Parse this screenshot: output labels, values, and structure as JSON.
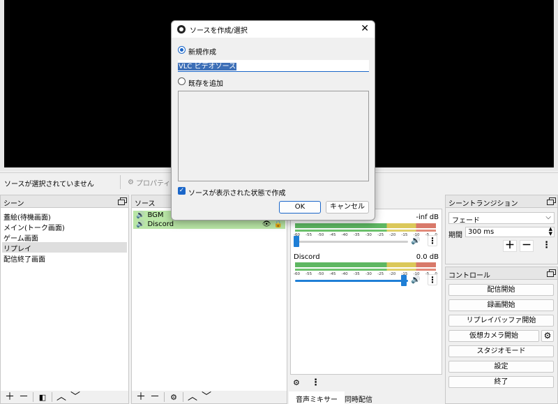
{
  "source_bar": {
    "no_source": "ソースが選択されていません",
    "properties": "プロパティ"
  },
  "scenes": {
    "title": "シーン",
    "items": [
      "蓋絵(待機画面)",
      "メイン(トーク画面)",
      "ゲーム画面",
      "リプレイ",
      "配信終了画面"
    ],
    "selected_index": 3
  },
  "sources": {
    "title": "ソース",
    "items": [
      {
        "name": "BGM"
      },
      {
        "name": "Discord"
      }
    ]
  },
  "mixer": {
    "channels": [
      {
        "name": "",
        "level": "-inf dB",
        "volume_fraction": 0.0
      },
      {
        "name": "Discord",
        "level": "0.0 dB",
        "volume_fraction": 1.0
      }
    ],
    "ticks": [
      "-60",
      "-55",
      "-50",
      "-45",
      "-40",
      "-35",
      "-30",
      "-25",
      "-20",
      "-15",
      "-10",
      "-5",
      "0"
    ],
    "tabs": [
      "音声ミキサー",
      "同時配信"
    ]
  },
  "transitions": {
    "title": "シーントランジション",
    "selected": "フェード",
    "duration_label": "期間",
    "duration_value": "300 ms"
  },
  "controls": {
    "title": "コントロール",
    "buttons": [
      "配信開始",
      "録画開始",
      "リプレイバッファ開始",
      "仮想カメラ開始",
      "スタジオモード",
      "設定",
      "終了"
    ]
  },
  "dialog": {
    "title": "ソースを作成/選択",
    "create_new": "新規作成",
    "name_value": "VLC ビデオソース",
    "add_existing": "既存を追加",
    "visible_checkbox": "ソースが表示された状態で作成",
    "ok": "OK",
    "cancel": "キャンセル",
    "accent": "#1a66c9"
  }
}
